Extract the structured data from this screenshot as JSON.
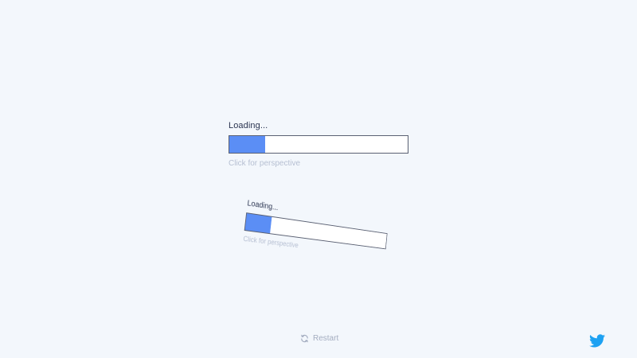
{
  "loader": {
    "title": "Loading...",
    "hint": "Click for perspective",
    "progress_percent": 20,
    "fill_color": "#5b8ef5",
    "track_color": "#ffffff",
    "border_color": "#5a6072"
  },
  "perspective_loader": {
    "title": "Loading...",
    "hint": "Click for perspective",
    "progress_percent": 16
  },
  "restart": {
    "label": "Restart",
    "icon": "refresh-icon"
  },
  "social": {
    "icon": "twitter-icon",
    "color": "#1da1f2"
  },
  "colors": {
    "background": "#f3f7fc",
    "muted_text": "#b6bfd2",
    "title_text": "#2a3450"
  }
}
